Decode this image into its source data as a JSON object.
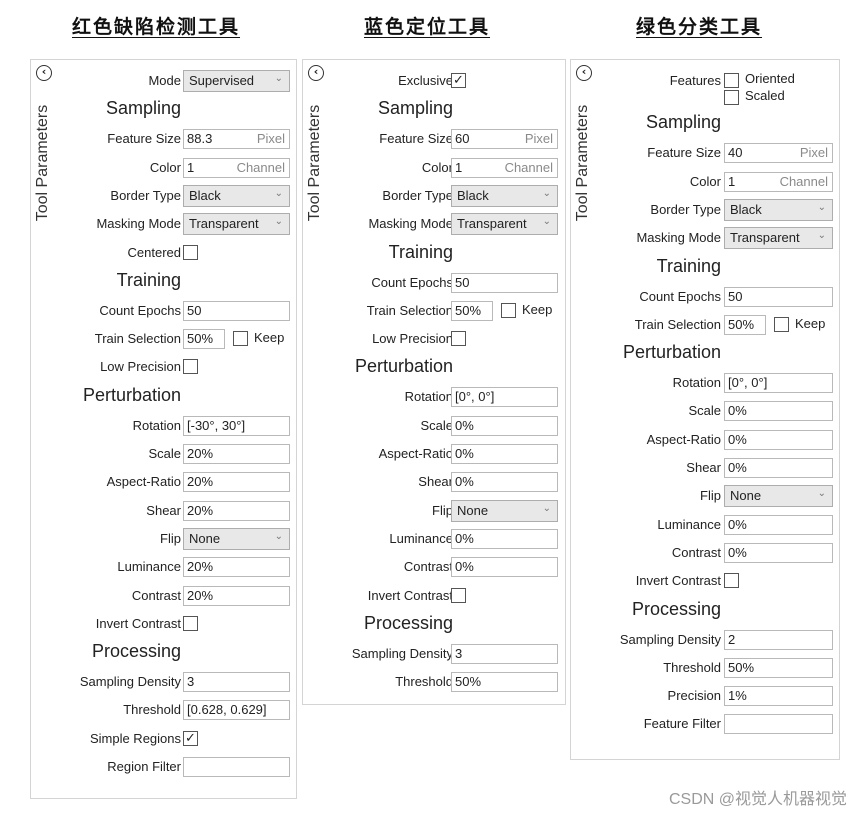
{
  "titles": [
    "红色缺陷检测工具",
    "蓝色定位工具",
    "绿色分类工具"
  ],
  "sidebar_label": "Tool Parameters",
  "icons": {
    "collapse": "chevron-left-circle-icon",
    "dropdown": "chevron-down-icon",
    "check": "checkmark-icon"
  },
  "glyphs": {
    "collapse": "‹",
    "chevron": "⌄",
    "check": "✓"
  },
  "panels": [
    {
      "name": "red-defect-detection",
      "rows": [
        {
          "type": "select",
          "label": "Mode",
          "value": "Supervised"
        },
        {
          "type": "section",
          "label": "Sampling"
        },
        {
          "type": "unit",
          "label": "Feature Size",
          "value": "88.3",
          "unit": "Pixel"
        },
        {
          "type": "unit",
          "label": "Color",
          "value": "1",
          "unit": "Channel"
        },
        {
          "type": "select",
          "label": "Border Type",
          "value": "Black"
        },
        {
          "type": "select",
          "label": "Masking Mode",
          "value": "Transparent"
        },
        {
          "type": "check",
          "label": "Centered",
          "checked": false
        },
        {
          "type": "section",
          "label": "Training"
        },
        {
          "type": "text",
          "label": "Count Epochs",
          "value": "50"
        },
        {
          "type": "trainsel",
          "label": "Train Selection",
          "value": "50%",
          "keep_label": "Keep",
          "keep": false
        },
        {
          "type": "check",
          "label": "Low Precision",
          "checked": false
        },
        {
          "type": "section",
          "label": "Perturbation"
        },
        {
          "type": "text",
          "label": "Rotation",
          "value": "[-30°, 30°]"
        },
        {
          "type": "text",
          "label": "Scale",
          "value": "20%"
        },
        {
          "type": "text",
          "label": "Aspect-Ratio",
          "value": "20%"
        },
        {
          "type": "text",
          "label": "Shear",
          "value": "20%"
        },
        {
          "type": "select",
          "label": "Flip",
          "value": "None"
        },
        {
          "type": "text",
          "label": "Luminance",
          "value": "20%"
        },
        {
          "type": "text",
          "label": "Contrast",
          "value": "20%"
        },
        {
          "type": "check",
          "label": "Invert Contrast",
          "checked": false
        },
        {
          "type": "section",
          "label": "Processing"
        },
        {
          "type": "text",
          "label": "Sampling Density",
          "value": "3"
        },
        {
          "type": "text",
          "label": "Threshold",
          "value": "[0.628, 0.629]"
        },
        {
          "type": "check",
          "label": "Simple Regions",
          "checked": true
        },
        {
          "type": "text",
          "label": "Region Filter",
          "value": ""
        }
      ]
    },
    {
      "name": "blue-locate",
      "rows": [
        {
          "type": "check",
          "label": "Exclusive",
          "checked": true
        },
        {
          "type": "section",
          "label": "Sampling"
        },
        {
          "type": "unit",
          "label": "Feature Size",
          "value": "60",
          "unit": "Pixel"
        },
        {
          "type": "unit",
          "label": "Color",
          "value": "1",
          "unit": "Channel"
        },
        {
          "type": "select",
          "label": "Border Type",
          "value": "Black"
        },
        {
          "type": "select",
          "label": "Masking Mode",
          "value": "Transparent"
        },
        {
          "type": "section",
          "label": "Training"
        },
        {
          "type": "text",
          "label": "Count Epochs",
          "value": "50"
        },
        {
          "type": "trainsel",
          "label": "Train Selection",
          "value": "50%",
          "keep_label": "Keep",
          "keep": false
        },
        {
          "type": "check",
          "label": "Low Precision",
          "checked": false
        },
        {
          "type": "section",
          "label": "Perturbation"
        },
        {
          "type": "text",
          "label": "Rotation",
          "value": "[0°, 0°]"
        },
        {
          "type": "text",
          "label": "Scale",
          "value": "0%"
        },
        {
          "type": "text",
          "label": "Aspect-Ratio",
          "value": "0%"
        },
        {
          "type": "text",
          "label": "Shear",
          "value": "0%"
        },
        {
          "type": "select",
          "label": "Flip",
          "value": "None"
        },
        {
          "type": "text",
          "label": "Luminance",
          "value": "0%"
        },
        {
          "type": "text",
          "label": "Contrast",
          "value": "0%"
        },
        {
          "type": "check",
          "label": "Invert Contrast",
          "checked": false
        },
        {
          "type": "section",
          "label": "Processing"
        },
        {
          "type": "text",
          "label": "Sampling Density",
          "value": "3"
        },
        {
          "type": "text",
          "label": "Threshold",
          "value": "50%"
        }
      ]
    },
    {
      "name": "green-classify",
      "rows": [
        {
          "type": "features",
          "label": "Features",
          "options": [
            {
              "label": "Oriented",
              "checked": false
            },
            {
              "label": "Scaled",
              "checked": false
            }
          ]
        },
        {
          "type": "section",
          "label": "Sampling"
        },
        {
          "type": "unit",
          "label": "Feature Size",
          "value": "40",
          "unit": "Pixel"
        },
        {
          "type": "unit",
          "label": "Color",
          "value": "1",
          "unit": "Channel"
        },
        {
          "type": "select",
          "label": "Border Type",
          "value": "Black"
        },
        {
          "type": "select",
          "label": "Masking Mode",
          "value": "Transparent"
        },
        {
          "type": "section",
          "label": "Training"
        },
        {
          "type": "text",
          "label": "Count Epochs",
          "value": "50"
        },
        {
          "type": "trainsel",
          "label": "Train Selection",
          "value": "50%",
          "keep_label": "Keep",
          "keep": false
        },
        {
          "type": "section",
          "label": "Perturbation"
        },
        {
          "type": "text",
          "label": "Rotation",
          "value": "[0°, 0°]"
        },
        {
          "type": "text",
          "label": "Scale",
          "value": "0%"
        },
        {
          "type": "text",
          "label": "Aspect-Ratio",
          "value": "0%"
        },
        {
          "type": "text",
          "label": "Shear",
          "value": "0%"
        },
        {
          "type": "select",
          "label": "Flip",
          "value": "None"
        },
        {
          "type": "text",
          "label": "Luminance",
          "value": "0%"
        },
        {
          "type": "text",
          "label": "Contrast",
          "value": "0%"
        },
        {
          "type": "check",
          "label": "Invert Contrast",
          "checked": false
        },
        {
          "type": "section",
          "label": "Processing"
        },
        {
          "type": "text",
          "label": "Sampling Density",
          "value": "2"
        },
        {
          "type": "text",
          "label": "Threshold",
          "value": "50%"
        },
        {
          "type": "text",
          "label": "Precision",
          "value": "1%"
        },
        {
          "type": "text",
          "label": "Feature Filter",
          "value": ""
        }
      ]
    }
  ],
  "watermark": "CSDN @视觉人机器视觉"
}
